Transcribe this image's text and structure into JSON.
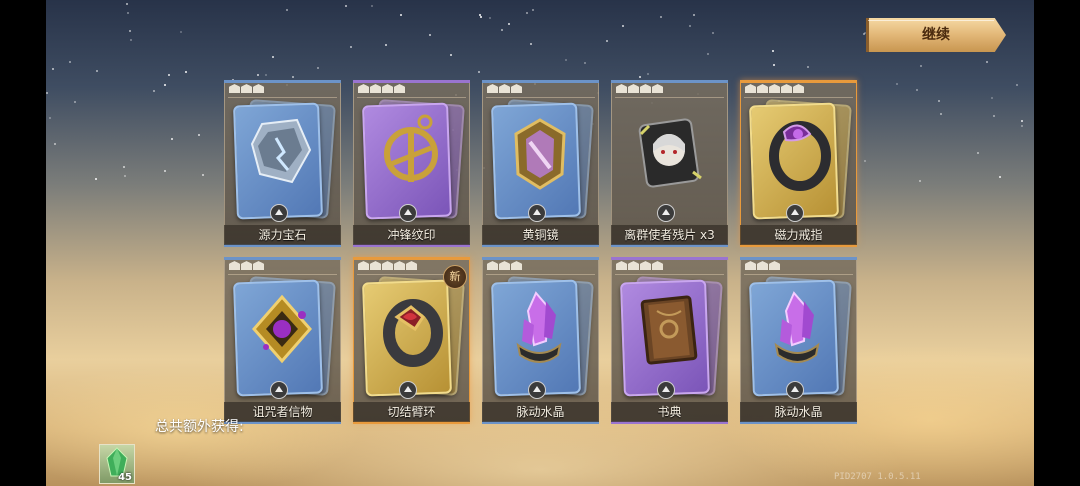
{
  "top_bar": {
    "continue_label": "继续"
  },
  "cards": [
    {
      "name": "源力宝石",
      "frame": "blue",
      "rank": 3,
      "border": "normal",
      "icon": "gem-icon",
      "is_new": false
    },
    {
      "name": "冲锋纹印",
      "frame": "purple",
      "rank": 4,
      "border": "normal",
      "icon": "emblem-icon",
      "is_new": false
    },
    {
      "name": "黄铜镜",
      "frame": "blue",
      "rank": 3,
      "border": "normal",
      "icon": "mirror-icon",
      "is_new": false
    },
    {
      "name": "离群使者残片 x3",
      "frame": "none",
      "rank": 4,
      "border": "normal",
      "icon": "hero-fragment-icon",
      "is_new": false
    },
    {
      "name": "磁力戒指",
      "frame": "gold",
      "rank": 5,
      "border": "orange",
      "icon": "ring-icon",
      "is_new": false
    },
    {
      "name": "诅咒者信物",
      "frame": "blue",
      "rank": 3,
      "border": "normal",
      "icon": "cursed-relic-icon",
      "is_new": false
    },
    {
      "name": "切结臂环",
      "frame": "gold",
      "rank": 5,
      "border": "orange",
      "icon": "bracelet-icon",
      "is_new": true,
      "new_label": "新"
    },
    {
      "name": "脉动水晶",
      "frame": "blue",
      "rank": 3,
      "border": "normal",
      "icon": "crystal-icon",
      "is_new": false
    },
    {
      "name": "书典",
      "frame": "purple",
      "rank": 4,
      "border": "normal",
      "icon": "book-icon",
      "is_new": false
    },
    {
      "name": "脉动水晶",
      "frame": "blue",
      "rank": 3,
      "border": "normal",
      "icon": "crystal-icon",
      "is_new": false
    }
  ],
  "extra": {
    "label": "总共额外获得:",
    "item_icon": "green-crystal-icon",
    "count": "45"
  },
  "version_text": "PID2707 1.0.5.11",
  "colors": {
    "blue_frame": "#6c93c8",
    "purple_frame": "#9a74d0",
    "gold_frame": "#d4b055",
    "orange_border": "#e89a3c",
    "button": "#e2b777"
  }
}
